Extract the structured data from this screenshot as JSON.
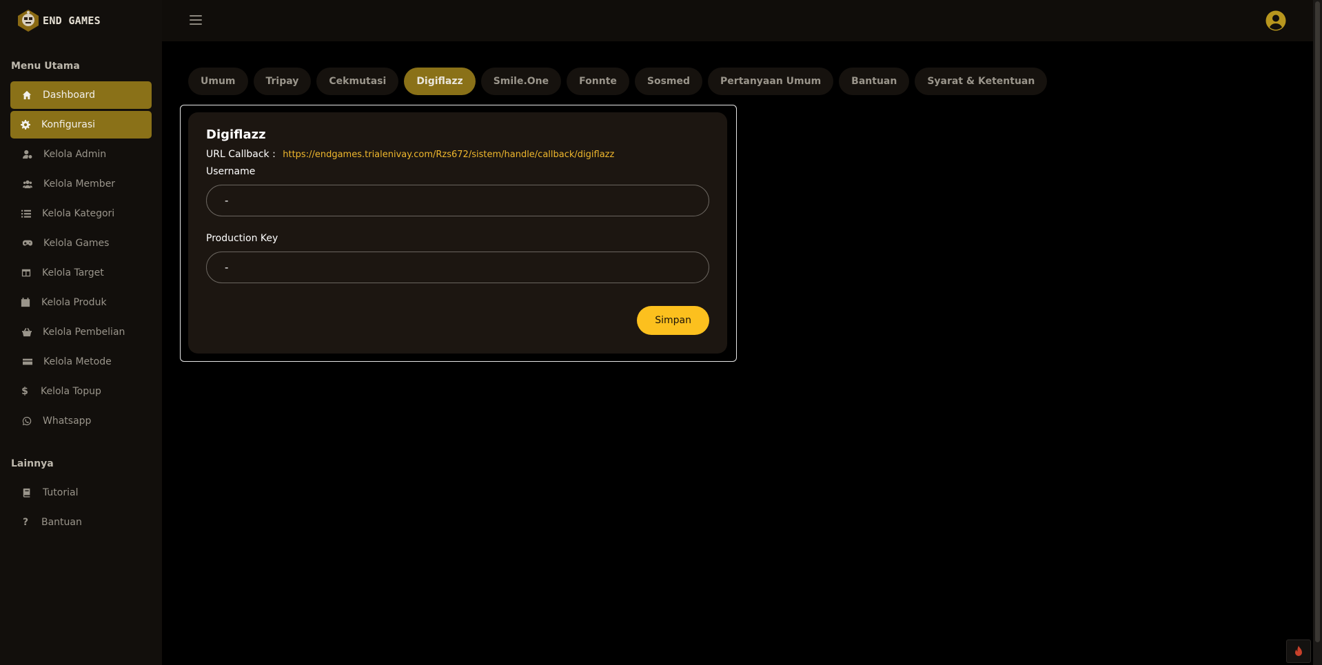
{
  "brand": {
    "name": "END GAMES",
    "logo_icon": "robot-face-logo-icon"
  },
  "sidebar": {
    "main_section_title": "Menu Utama",
    "main_items": [
      {
        "label": "Dashboard",
        "icon": "home-icon",
        "active": true
      },
      {
        "label": "Konfigurasi",
        "icon": "gear-icon",
        "active": true
      },
      {
        "label": "Kelola Admin",
        "icon": "user-cog-icon"
      },
      {
        "label": "Kelola Member",
        "icon": "users-icon"
      },
      {
        "label": "Kelola Kategori",
        "icon": "list-icon"
      },
      {
        "label": "Kelola Games",
        "icon": "gamepad-icon"
      },
      {
        "label": "Kelola Target",
        "icon": "table-icon"
      },
      {
        "label": "Kelola Produk",
        "icon": "calendar-icon"
      },
      {
        "label": "Kelola Pembelian",
        "icon": "basket-icon"
      },
      {
        "label": "Kelola Metode",
        "icon": "credit-card-icon"
      },
      {
        "label": "Kelola Topup",
        "icon": "dollar-icon"
      },
      {
        "label": "Whatsapp",
        "icon": "whatsapp-icon"
      }
    ],
    "other_section_title": "Lainnya",
    "other_items": [
      {
        "label": "Tutorial",
        "icon": "book-icon"
      },
      {
        "label": "Bantuan",
        "icon": "question-icon"
      }
    ]
  },
  "header": {
    "menu_icon": "hamburger-icon",
    "avatar_icon": "user-circle-icon"
  },
  "tabs": [
    {
      "label": "Umum"
    },
    {
      "label": "Tripay"
    },
    {
      "label": "Cekmutasi"
    },
    {
      "label": "Digiflazz",
      "active": true
    },
    {
      "label": "Smile.One"
    },
    {
      "label": "Fonnte"
    },
    {
      "label": "Sosmed"
    },
    {
      "label": "Pertanyaan Umum"
    },
    {
      "label": "Bantuan"
    },
    {
      "label": "Syarat & Ketentuan"
    }
  ],
  "form": {
    "title": "Digiflazz",
    "callback_label": "URL Callback :",
    "callback_url": "https://endgames.trialenivay.com/Rzs672/sistem/handle/callback/digiflazz",
    "username_label": "Username",
    "username_value": "-",
    "production_key_label": "Production Key",
    "production_key_value": "-",
    "save_label": "Simpan"
  },
  "colors": {
    "accent": "#fcc01e",
    "active_bg": "#8a7118",
    "link": "#f0b82d",
    "card_bg": "#1c1611",
    "sidebar_bg": "#120f0c"
  }
}
